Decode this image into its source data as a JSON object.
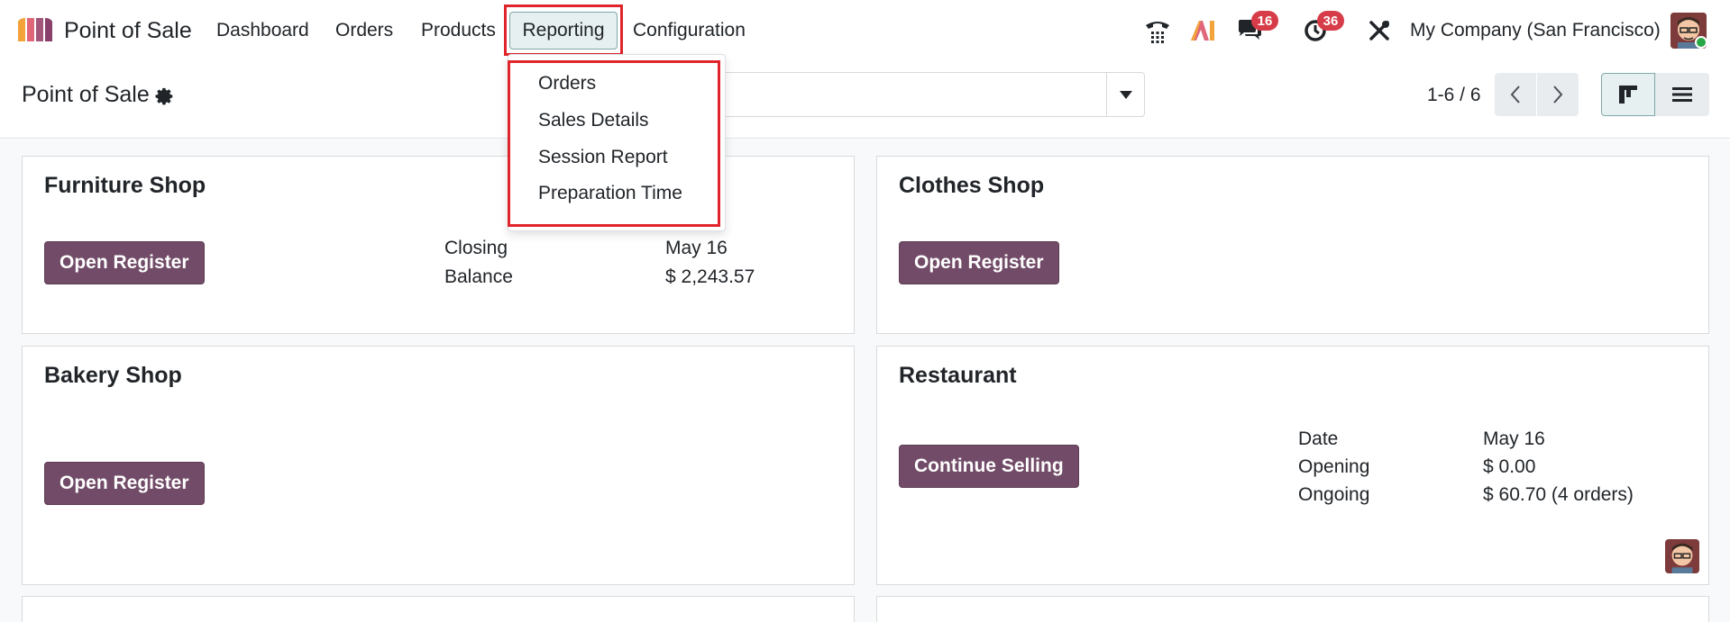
{
  "navbar": {
    "app_name": "Point of Sale",
    "menu": {
      "dashboard": "Dashboard",
      "orders": "Orders",
      "products": "Products",
      "reporting": "Reporting",
      "configuration": "Configuration"
    },
    "discuss_badge": "16",
    "activity_badge": "36",
    "company": "My Company (San Francisco)",
    "icons": [
      "phone-icon",
      "ai-icon",
      "chat-icon",
      "clock-icon",
      "tools-icon",
      "avatar"
    ]
  },
  "reporting_menu": {
    "items": [
      "Orders",
      "Sales Details",
      "Session Report",
      "Preparation Time"
    ]
  },
  "control_panel": {
    "title": "Point of Sale",
    "pager": "1-6 / 6"
  },
  "cards": {
    "furniture": {
      "title": "Furniture Shop",
      "button": "Open Register",
      "closing_label": "Closing",
      "closing_value": "May 16",
      "balance_label": "Balance",
      "balance_value": "$ 2,243.57"
    },
    "clothes": {
      "title": "Clothes Shop",
      "button": "Open Register"
    },
    "bakery": {
      "title": "Bakery Shop",
      "button": "Open Register"
    },
    "restaurant": {
      "title": "Restaurant",
      "button": "Continue Selling",
      "date_label": "Date",
      "date_value": "May 16",
      "opening_label": "Opening",
      "opening_value": "$ 0.00",
      "ongoing_label": "Ongoing",
      "ongoing_value": "$ 60.70 (4 orders)"
    }
  },
  "colors": {
    "primary": "#714b67",
    "highlight": "#e0242b",
    "badge": "#d73d48",
    "active_tab_bg": "#e6f0f0"
  }
}
